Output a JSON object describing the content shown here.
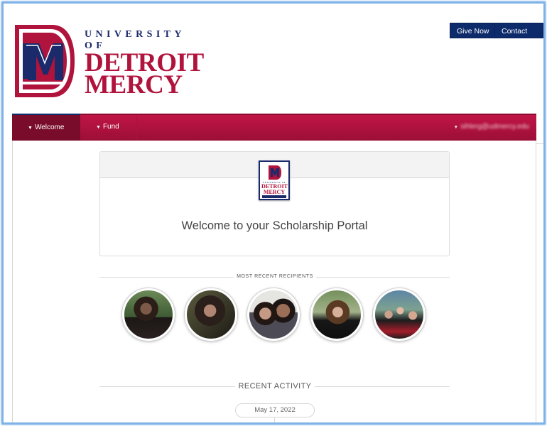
{
  "header": {
    "logo": {
      "line1": "UNIVERSITY OF",
      "line2": "DETROIT",
      "line3": "MERCY"
    },
    "buttons": {
      "give_now": "Give Now",
      "contact_us": "Contact Us"
    }
  },
  "nav": {
    "items": [
      {
        "label": "Welcome",
        "active": true
      },
      {
        "label": "Fund",
        "active": false
      }
    ],
    "user_email": "sihlerg@udmercy.edu"
  },
  "welcome_card": {
    "logo": {
      "line1": "UNIVERSITY OF",
      "line2": "DETROIT",
      "line3": "MERCY"
    },
    "title": "Welcome to your Scholarship Portal"
  },
  "recipients": {
    "label": "MOST RECENT RECIPIENTS",
    "count": 5
  },
  "activity": {
    "label": "RECENT ACTIVITY",
    "date": "May 17, 2022"
  },
  "colors": {
    "brand_red": "#b0133c",
    "brand_navy": "#0d2a6b",
    "nav_active": "#7a0c2b",
    "frame_border": "#7fb2e6"
  }
}
